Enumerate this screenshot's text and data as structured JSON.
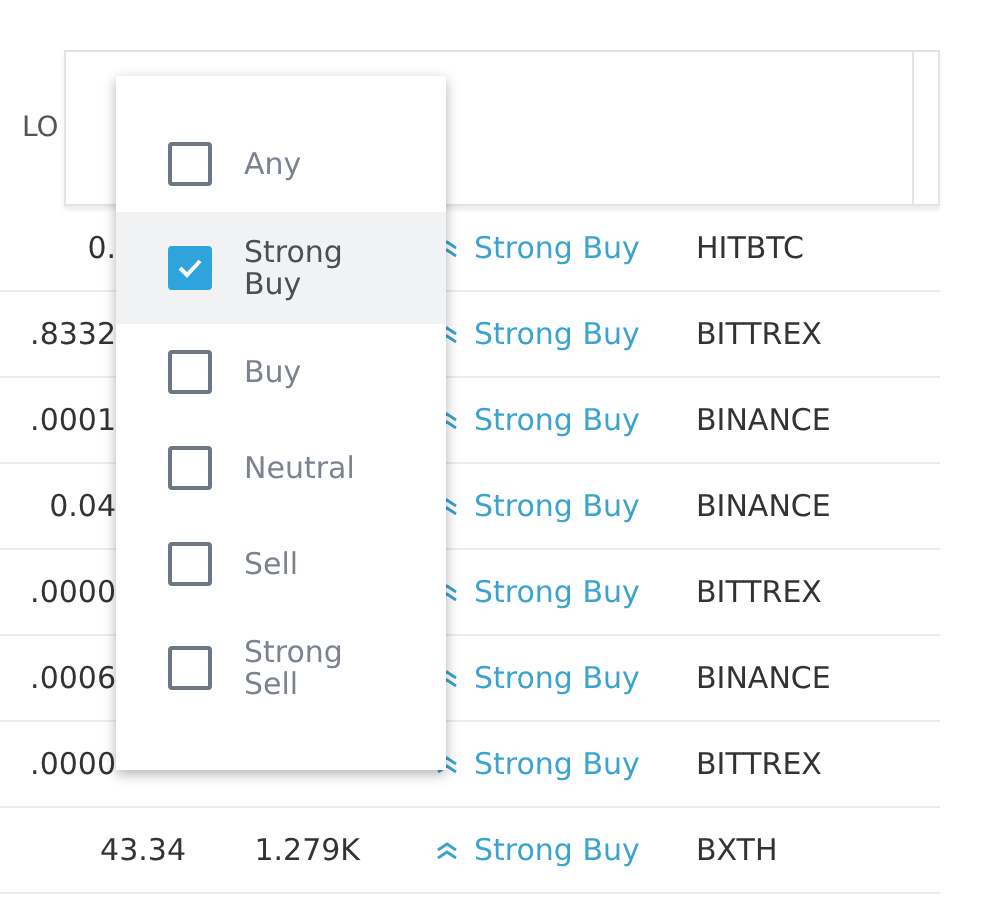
{
  "header": {
    "column_label": "LO"
  },
  "rows": [
    {
      "price": "0.",
      "rating": "Strong Buy",
      "exchange": "HITBTC"
    },
    {
      "price": ".8332",
      "rating": "Strong Buy",
      "exchange": "BITTREX"
    },
    {
      "price": ".0001",
      "rating": "Strong Buy",
      "exchange": "BINANCE"
    },
    {
      "price": "0.04",
      "rating": "Strong Buy",
      "exchange": "BINANCE"
    },
    {
      "price": ".0000",
      "rating": "Strong Buy",
      "exchange": "BITTREX"
    },
    {
      "price": ".0006",
      "rating": "Strong Buy",
      "exchange": "BINANCE"
    },
    {
      "price": ".0000",
      "rating": "Strong Buy",
      "exchange": "BITTREX"
    },
    {
      "price": "43.34",
      "volume": "1.279K",
      "rating": "Strong Buy",
      "exchange": "BXTH"
    }
  ],
  "rating_filter": {
    "options": [
      {
        "label": "Any",
        "checked": false,
        "highlighted": false
      },
      {
        "label": "Strong Buy",
        "checked": true,
        "highlighted": true
      },
      {
        "label": "Buy",
        "checked": false,
        "highlighted": false
      },
      {
        "label": "Neutral",
        "checked": false,
        "highlighted": false
      },
      {
        "label": "Sell",
        "checked": false,
        "highlighted": false
      },
      {
        "label": "Strong Sell",
        "checked": false,
        "highlighted": false
      }
    ]
  }
}
